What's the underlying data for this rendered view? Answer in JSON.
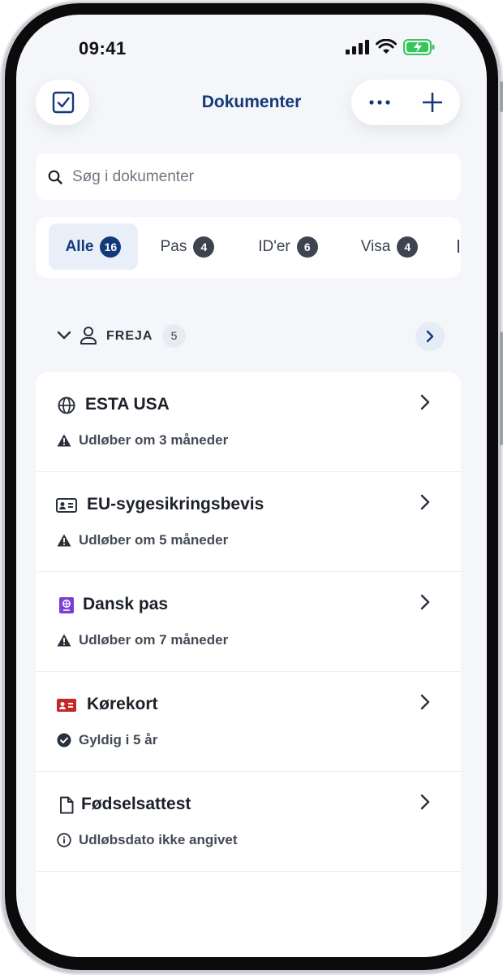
{
  "status_bar": {
    "time": "09:41",
    "battery_color": "#34c759"
  },
  "header": {
    "title": "Dokumenter",
    "more_icon": "ellipsis-icon",
    "add_icon": "plus-icon",
    "select_icon": "checkbox-icon"
  },
  "search": {
    "placeholder": "Søg i dokumenter"
  },
  "tabs": [
    {
      "label": "Alle",
      "count": "16",
      "active": true
    },
    {
      "label": "Pas",
      "count": "4",
      "active": false
    },
    {
      "label": "ID'er",
      "count": "6",
      "active": false
    },
    {
      "label": "Visa",
      "count": "4",
      "active": false
    }
  ],
  "group": {
    "name": "FREJA",
    "count": "5"
  },
  "documents": [
    {
      "name": "ESTA USA",
      "icon": "globe-icon",
      "status": "Udløber om 3 måneder",
      "status_icon": "warning-icon"
    },
    {
      "name": "EU-sygesikringsbevis",
      "icon": "id-card-icon",
      "status": "Udløber om 5 måneder",
      "status_icon": "warning-icon"
    },
    {
      "name": "Dansk pas",
      "icon": "passport-icon",
      "status": "Udløber om 7 måneder",
      "status_icon": "warning-icon"
    },
    {
      "name": "Kørekort",
      "icon": "driving-license-icon",
      "status": "Gyldig i 5 år",
      "status_icon": "check-circle-icon"
    },
    {
      "name": "Fødselsattest",
      "icon": "document-icon",
      "status": "Udløbsdato ikke angivet",
      "status_icon": "info-icon"
    }
  ],
  "colors": {
    "accent": "#14397a",
    "passport": "#7b3fd4",
    "license": "#c62828",
    "background": "#f4f6f9"
  }
}
